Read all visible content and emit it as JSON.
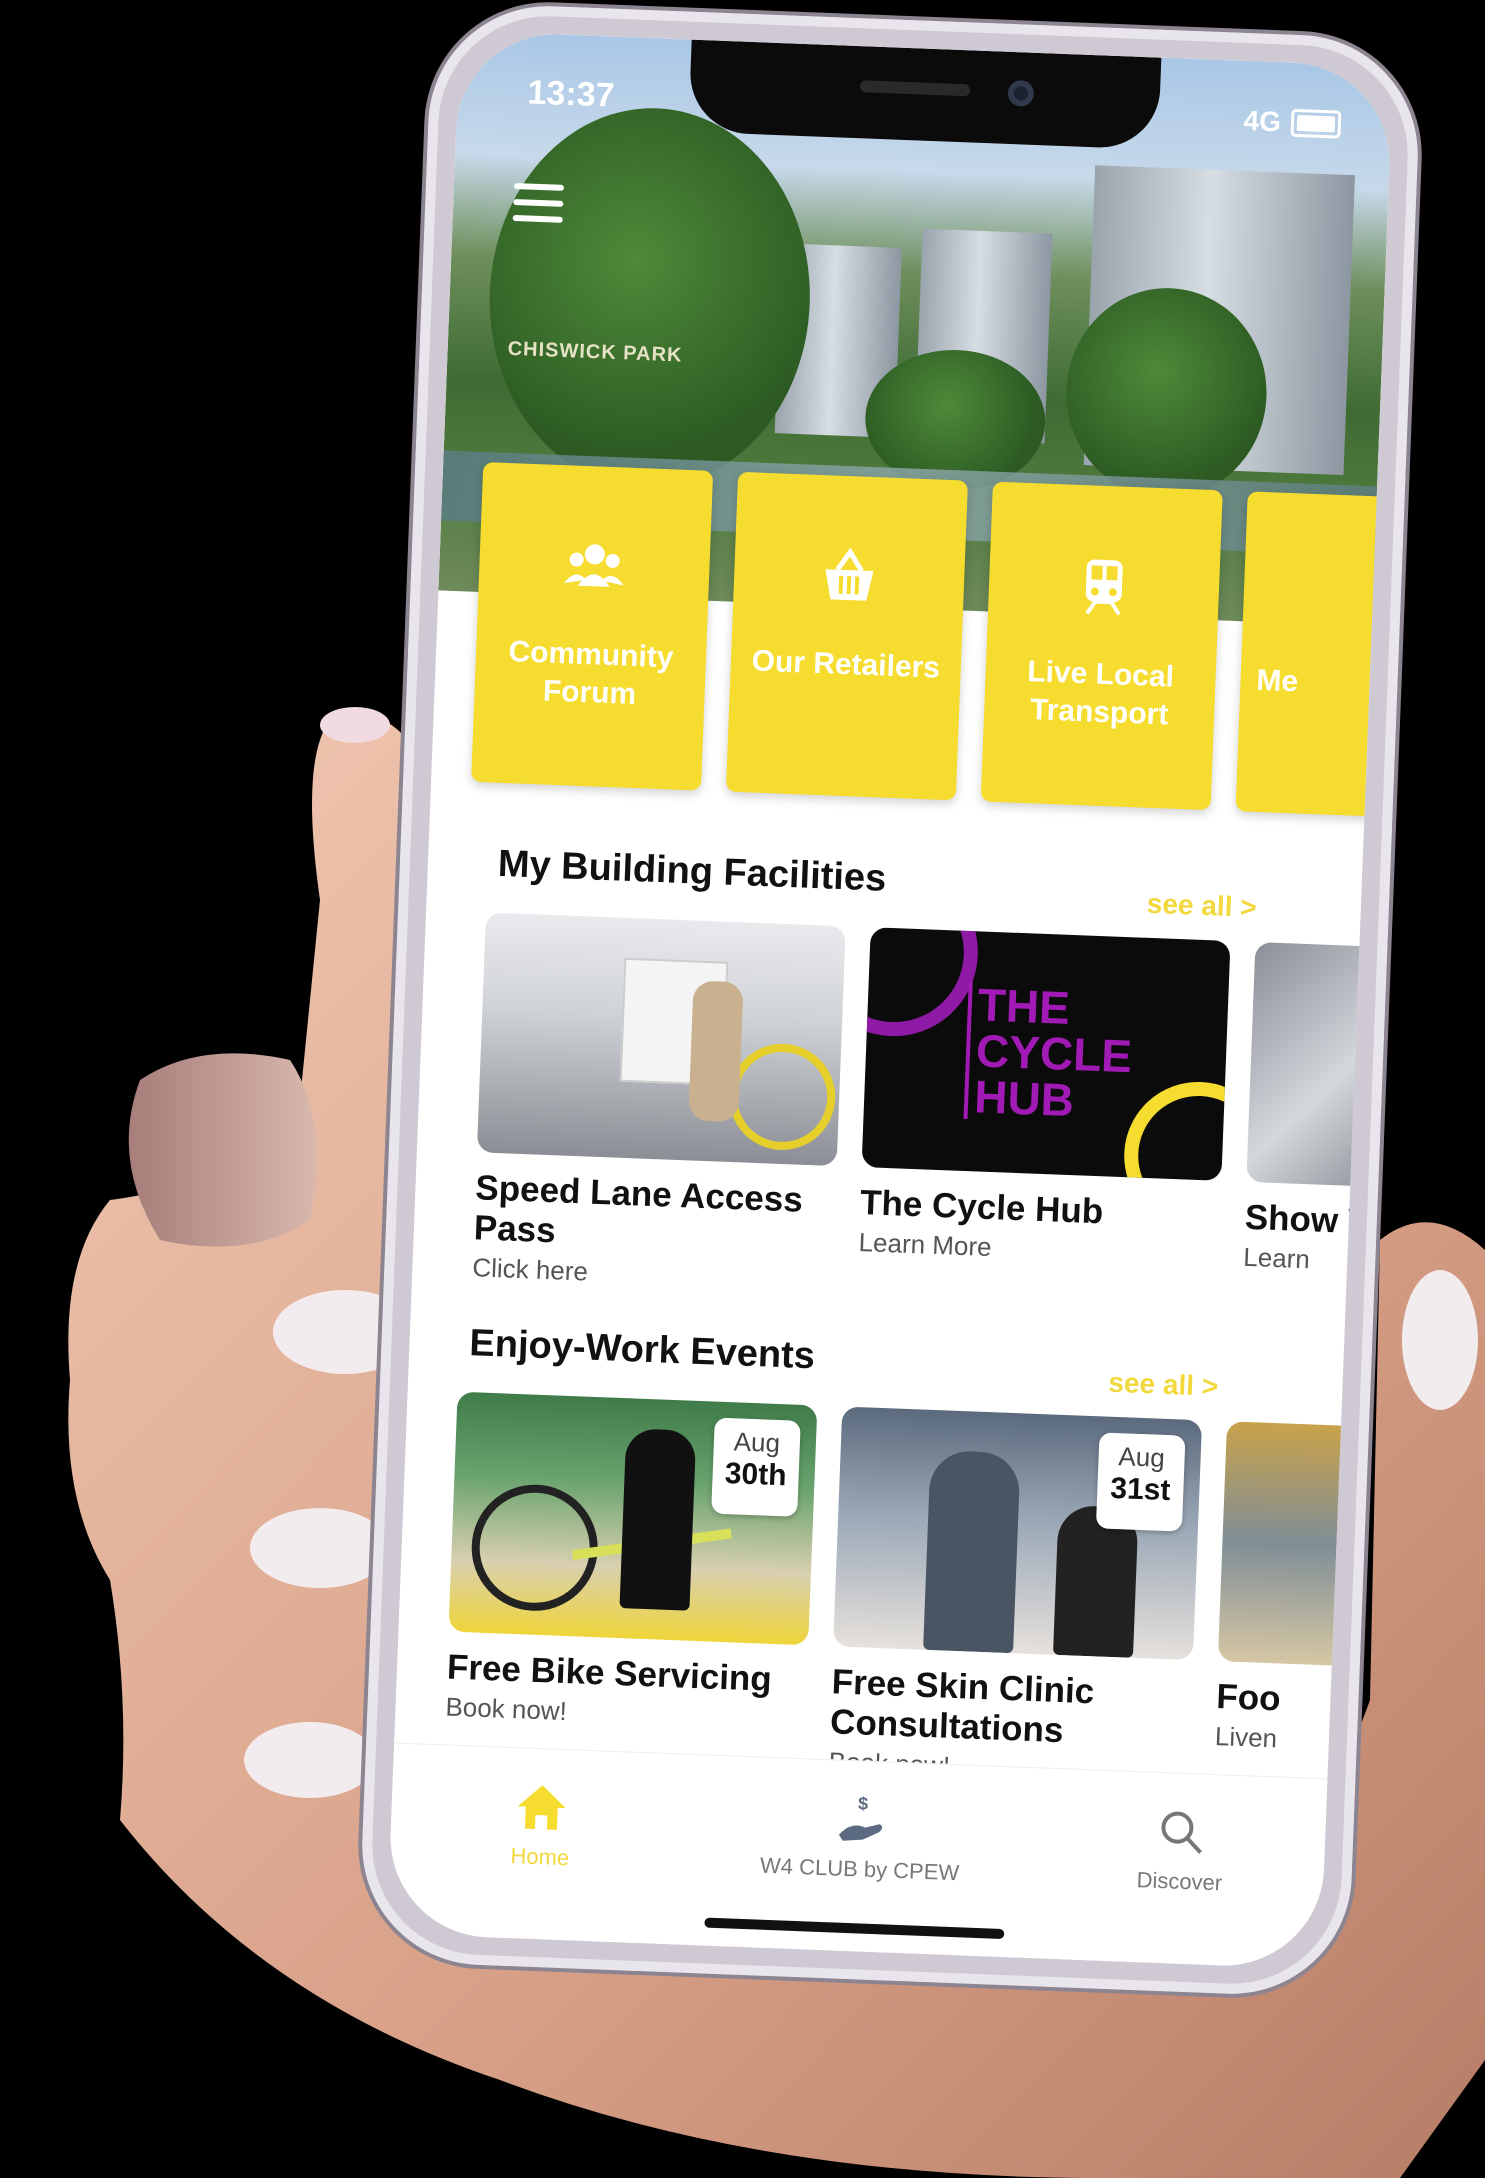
{
  "status_bar": {
    "time": "13:37",
    "network": "4G"
  },
  "hero": {
    "logo_text": "CHISWICK PARK"
  },
  "quick_links": [
    {
      "label": "Community Forum",
      "icon": "people-icon"
    },
    {
      "label": "Our Retailers",
      "icon": "basket-icon"
    },
    {
      "label": "Live Local Transport",
      "icon": "train-icon"
    },
    {
      "label": "Me",
      "icon": "more-icon"
    }
  ],
  "facilities": {
    "title": "My Building Facilities",
    "see_all": "see all >",
    "cards": [
      {
        "title": "Speed Lane Access Pass",
        "subtitle": "Click here"
      },
      {
        "title": "The Cycle Hub",
        "subtitle": "Learn More",
        "image_text": "THE CYCLE HUB"
      },
      {
        "title": "Show Was",
        "subtitle": "Learn"
      }
    ]
  },
  "events": {
    "title": "Enjoy-Work Events",
    "see_all": "see all >",
    "cards": [
      {
        "title": "Free Bike Servicing",
        "subtitle": "Book now!",
        "month": "Aug",
        "day": "30th"
      },
      {
        "title": "Free Skin Clinic Consultations",
        "subtitle": "Book now!",
        "month": "Aug",
        "day": "31st"
      },
      {
        "title": "Foo",
        "subtitle": "Liven"
      }
    ]
  },
  "tab_bar": [
    {
      "label": "Home",
      "icon": "home-icon",
      "active": true
    },
    {
      "label": "W4 CLUB by CPEW",
      "icon": "hand-coin-icon",
      "active": false
    },
    {
      "label": "Discover",
      "icon": "search-icon",
      "active": false
    }
  ],
  "colors": {
    "accent": "#f6dc2f",
    "background": "#000000",
    "text": "#111111"
  }
}
